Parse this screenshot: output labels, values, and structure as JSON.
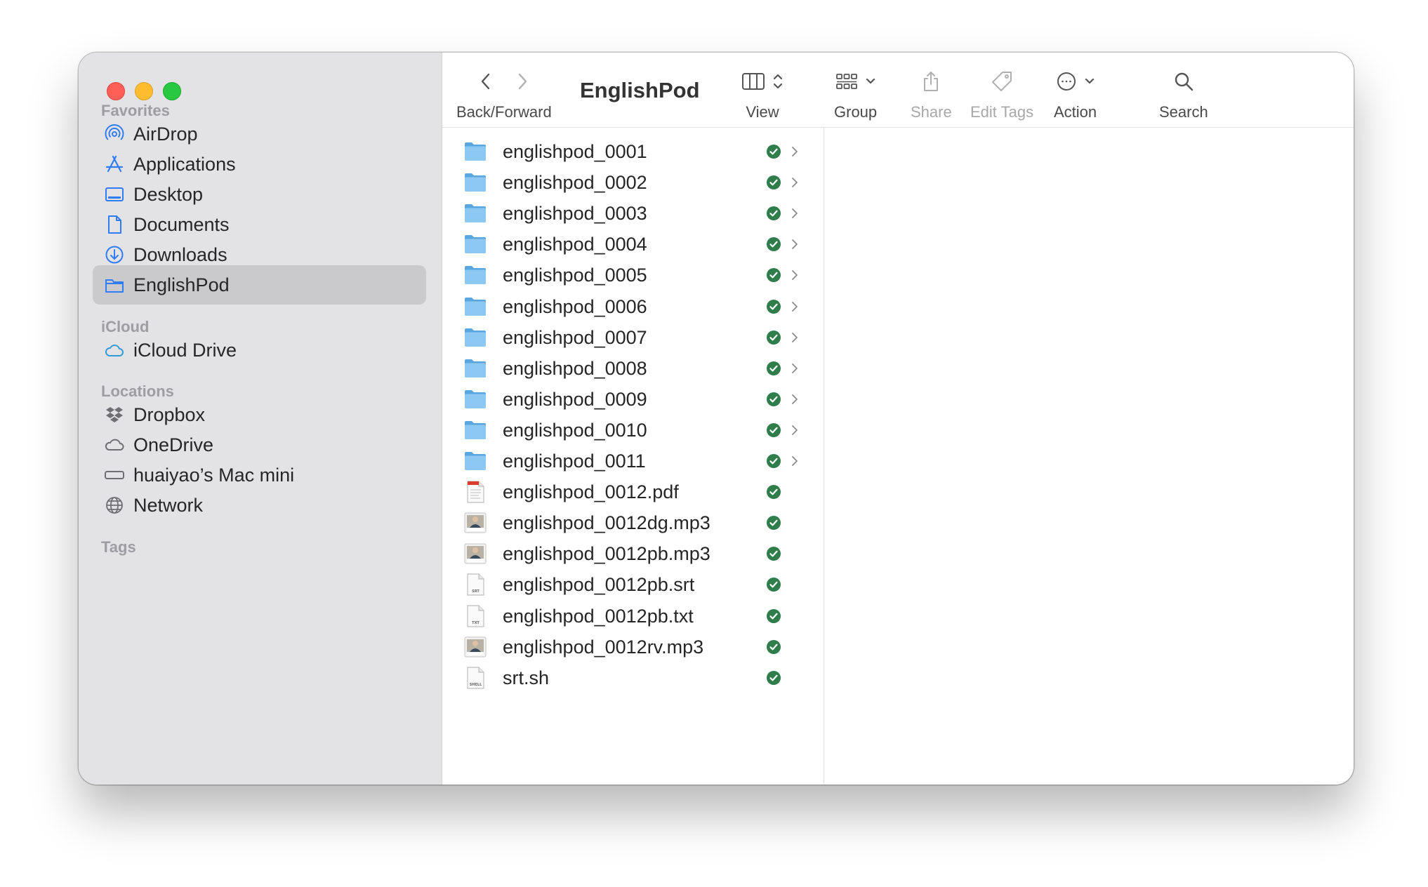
{
  "window": {
    "title": "EnglishPod"
  },
  "toolbar": {
    "back_forward_label": "Back/Forward",
    "view_label": "View",
    "group_label": "Group",
    "share_label": "Share",
    "edit_tags_label": "Edit Tags",
    "action_label": "Action",
    "search_label": "Search"
  },
  "sidebar": {
    "favorites_title": "Favorites",
    "favorites": [
      {
        "label": "AirDrop",
        "icon": "airdrop-icon"
      },
      {
        "label": "Applications",
        "icon": "applications-icon"
      },
      {
        "label": "Desktop",
        "icon": "desktop-icon"
      },
      {
        "label": "Documents",
        "icon": "document-icon"
      },
      {
        "label": "Downloads",
        "icon": "download-icon"
      },
      {
        "label": "EnglishPod",
        "icon": "folder-icon",
        "selected": true
      }
    ],
    "icloud_title": "iCloud",
    "icloud": [
      {
        "label": "iCloud Drive",
        "icon": "cloud-icon"
      }
    ],
    "locations_title": "Locations",
    "locations": [
      {
        "label": "Dropbox",
        "icon": "dropbox-icon"
      },
      {
        "label": "OneDrive",
        "icon": "cloud-icon"
      },
      {
        "label": "huaiyao’s Mac mini",
        "icon": "computer-icon"
      },
      {
        "label": "Network",
        "icon": "globe-icon"
      }
    ],
    "tags_title": "Tags"
  },
  "files": [
    {
      "name": "englishpod_0001",
      "kind": "folder"
    },
    {
      "name": "englishpod_0002",
      "kind": "folder"
    },
    {
      "name": "englishpod_0003",
      "kind": "folder"
    },
    {
      "name": "englishpod_0004",
      "kind": "folder"
    },
    {
      "name": "englishpod_0005",
      "kind": "folder"
    },
    {
      "name": "englishpod_0006",
      "kind": "folder"
    },
    {
      "name": "englishpod_0007",
      "kind": "folder"
    },
    {
      "name": "englishpod_0008",
      "kind": "folder"
    },
    {
      "name": "englishpod_0009",
      "kind": "folder"
    },
    {
      "name": "englishpod_0010",
      "kind": "folder"
    },
    {
      "name": "englishpod_0011",
      "kind": "folder"
    },
    {
      "name": "englishpod_0012.pdf",
      "kind": "pdf"
    },
    {
      "name": "englishpod_0012dg.mp3",
      "kind": "mp3"
    },
    {
      "name": "englishpod_0012pb.mp3",
      "kind": "mp3"
    },
    {
      "name": "englishpod_0012pb.srt",
      "kind": "srt",
      "badge": "SRT"
    },
    {
      "name": "englishpod_0012pb.txt",
      "kind": "txt",
      "badge": "TXT"
    },
    {
      "name": "englishpod_0012rv.mp3",
      "kind": "mp3"
    },
    {
      "name": "srt.sh",
      "kind": "shell",
      "badge": "SHELL"
    }
  ],
  "colors": {
    "accent": "#2f7cf6",
    "sync_green": "#2f7d4a",
    "folder_blue": "#74b9ec",
    "sidebar_bg": "#e3e3e6",
    "selected_bg": "#cacacd"
  }
}
